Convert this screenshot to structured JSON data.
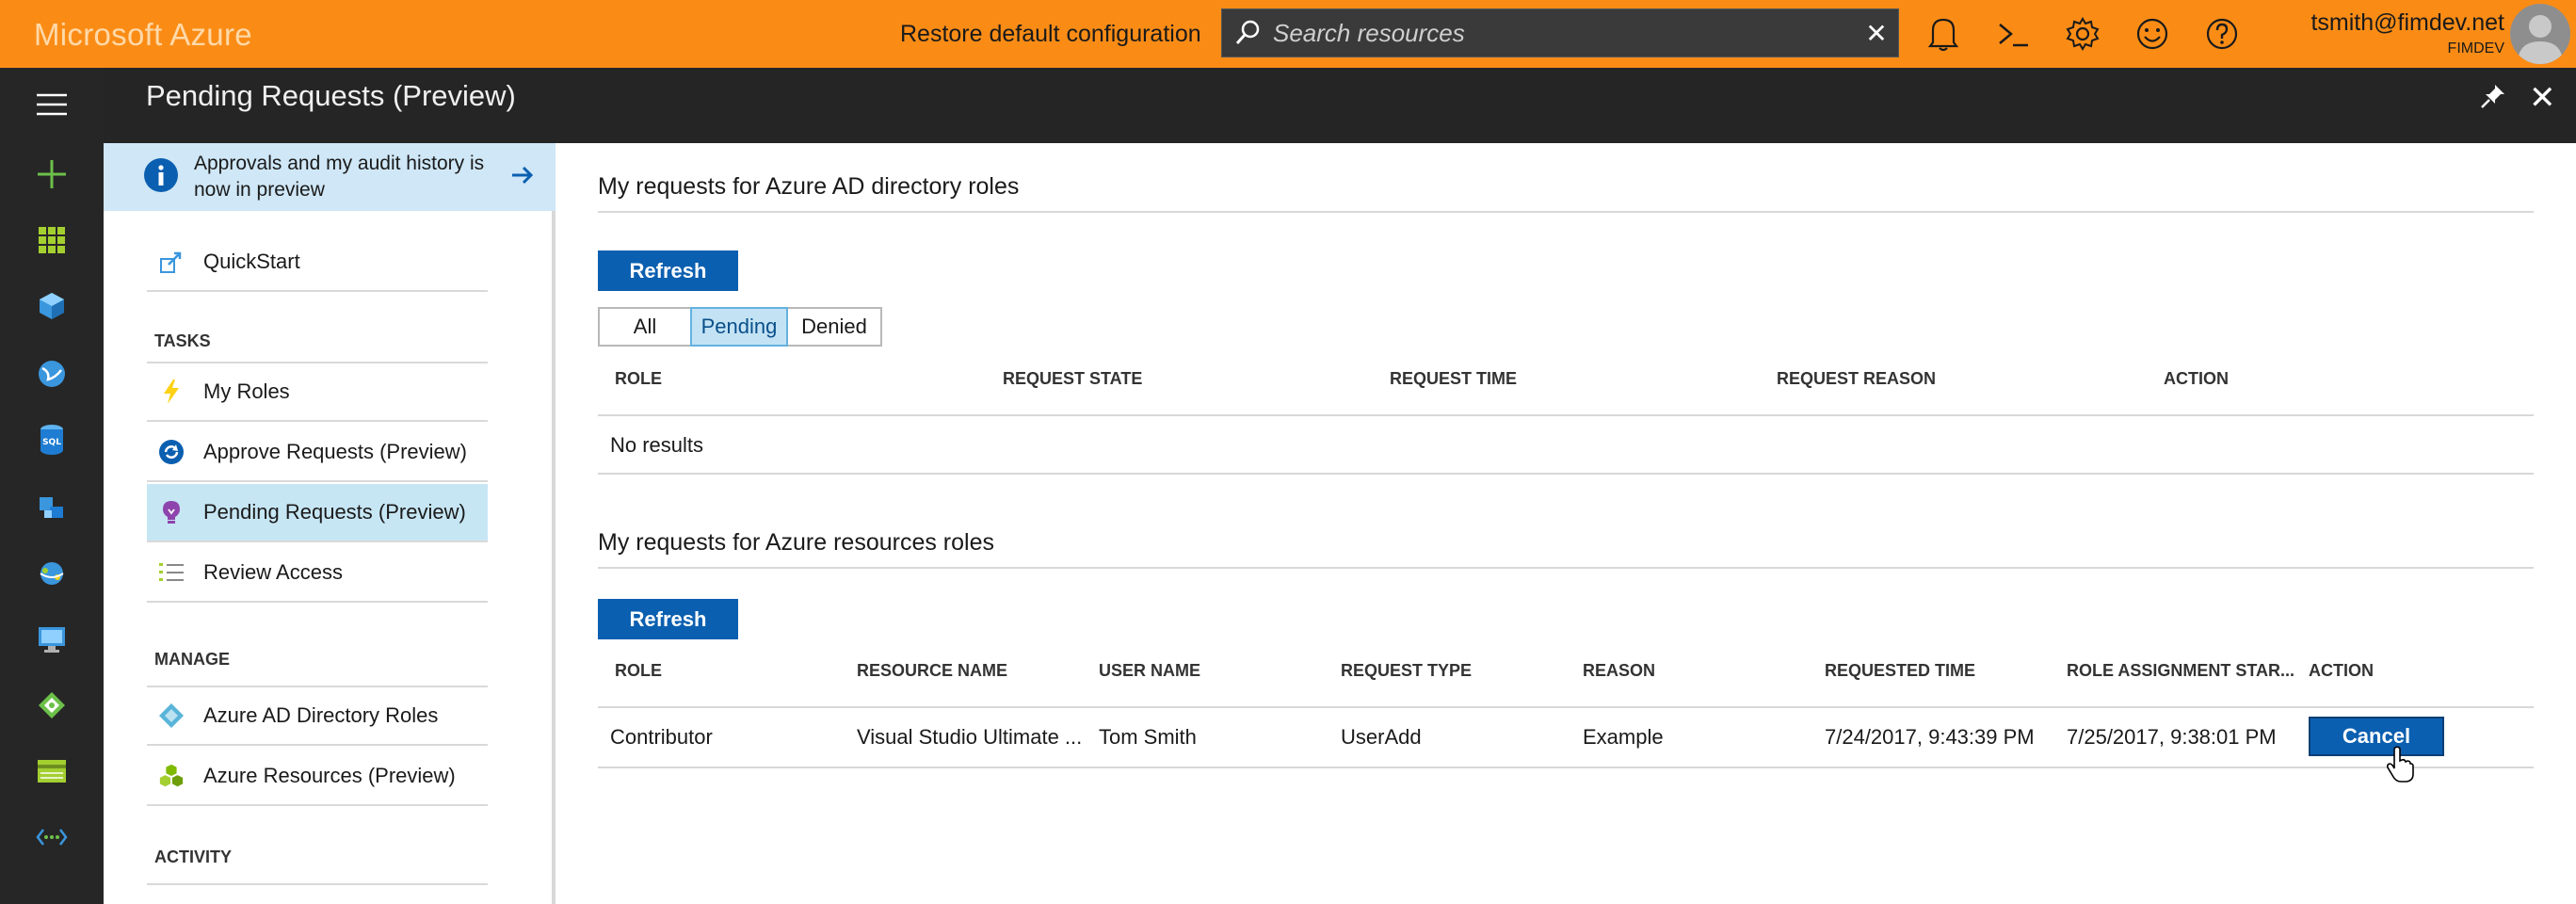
{
  "topbar": {
    "brand": "Microsoft Azure",
    "restore_label": "Restore default configuration",
    "search_placeholder": "Search resources",
    "user_email": "tsmith@fimdev.net",
    "user_tenant": "FIMDEV"
  },
  "blade": {
    "title": "Pending Requests (Preview)"
  },
  "menu": {
    "banner": "Approvals and my audit history is now in preview",
    "quickstart": "QuickStart",
    "sections": {
      "tasks": "TASKS",
      "manage": "MANAGE",
      "activity": "ACTIVITY"
    },
    "tasks": [
      {
        "label": "My Roles",
        "icon": "lightning-icon"
      },
      {
        "label": "Approve Requests (Preview)",
        "icon": "refresh-circle-icon"
      },
      {
        "label": "Pending Requests (Preview)",
        "icon": "bulb-icon",
        "selected": true
      },
      {
        "label": "Review Access",
        "icon": "checklist-icon"
      }
    ],
    "manage": [
      {
        "label": "Azure AD Directory Roles",
        "icon": "diamond-icon"
      },
      {
        "label": "Azure Resources (Preview)",
        "icon": "cubes-icon"
      }
    ]
  },
  "directory": {
    "heading": "My requests for Azure AD directory roles",
    "refresh_label": "Refresh",
    "filters": [
      "All",
      "Pending",
      "Denied"
    ],
    "active_filter": "Pending",
    "columns": [
      "ROLE",
      "REQUEST STATE",
      "REQUEST TIME",
      "REQUEST REASON",
      "ACTION"
    ],
    "empty_text": "No results"
  },
  "resources": {
    "heading": "My requests for Azure resources roles",
    "refresh_label": "Refresh",
    "columns": [
      "ROLE",
      "RESOURCE NAME",
      "USER NAME",
      "REQUEST TYPE",
      "REASON",
      "REQUESTED TIME",
      "ROLE ASSIGNMENT STAR...",
      "ACTION"
    ],
    "rows": [
      {
        "role": "Contributor",
        "resource_name": "Visual Studio Ultimate ...",
        "user_name": "Tom Smith",
        "request_type": "UserAdd",
        "reason": "Example",
        "requested_time": "7/24/2017, 9:43:39 PM",
        "role_assignment_start": "7/25/2017, 9:38:01 PM",
        "action": "Cancel"
      }
    ]
  },
  "colors": {
    "topbar": "#fa8c16",
    "rail": "#262626",
    "accent_button": "#0b5fb0",
    "selected_item": "#c7e6f4"
  }
}
